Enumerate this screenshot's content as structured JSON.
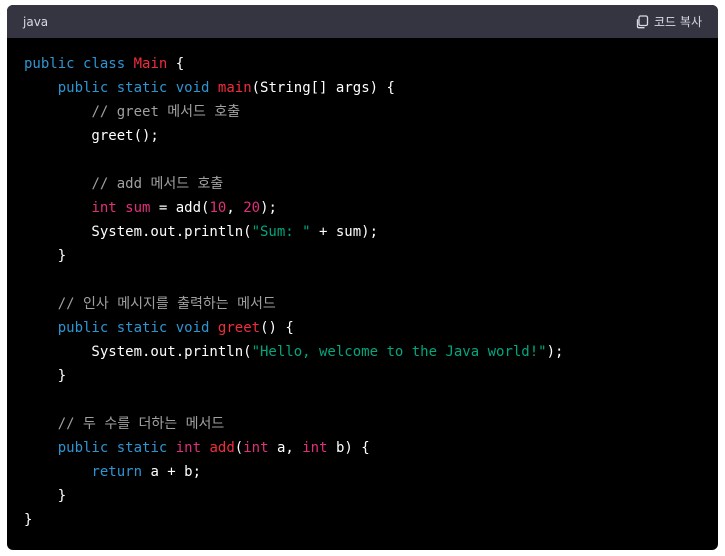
{
  "header": {
    "language": "java",
    "copy_label": "코드 복사",
    "copy_icon": "copy-icon"
  },
  "colors": {
    "keyword": "#2e95d3",
    "class_name": "#f22c3d",
    "function_name": "#f22c3d",
    "type_int": "#df3079",
    "number": "#df3079",
    "string": "#00a67d",
    "comment": "#a0a0a0",
    "plain": "#ffffff",
    "background": "#000000",
    "header_bg": "#343541"
  },
  "code": {
    "lines": [
      [
        {
          "t": "public",
          "c": "kw"
        },
        {
          "t": " ",
          "c": "pl"
        },
        {
          "t": "class",
          "c": "kw"
        },
        {
          "t": " ",
          "c": "pl"
        },
        {
          "t": "Main",
          "c": "cls"
        },
        {
          "t": " {",
          "c": "pl"
        }
      ],
      [
        {
          "t": "    ",
          "c": "pl"
        },
        {
          "t": "public",
          "c": "kw"
        },
        {
          "t": " ",
          "c": "pl"
        },
        {
          "t": "static",
          "c": "kw"
        },
        {
          "t": " ",
          "c": "pl"
        },
        {
          "t": "void",
          "c": "kw"
        },
        {
          "t": " ",
          "c": "pl"
        },
        {
          "t": "main",
          "c": "fn"
        },
        {
          "t": "(String[] args) {",
          "c": "pl"
        }
      ],
      [
        {
          "t": "        ",
          "c": "pl"
        },
        {
          "t": "// greet 메서드 호출",
          "c": "cm"
        }
      ],
      [
        {
          "t": "        greet();",
          "c": "pl"
        }
      ],
      [
        {
          "t": "",
          "c": "pl"
        }
      ],
      [
        {
          "t": "        ",
          "c": "pl"
        },
        {
          "t": "// add 메서드 호출",
          "c": "cm"
        }
      ],
      [
        {
          "t": "        ",
          "c": "pl"
        },
        {
          "t": "int",
          "c": "dt"
        },
        {
          "t": " ",
          "c": "pl"
        },
        {
          "t": "sum",
          "c": "dt"
        },
        {
          "t": " = add(",
          "c": "pl"
        },
        {
          "t": "10",
          "c": "num"
        },
        {
          "t": ", ",
          "c": "pl"
        },
        {
          "t": "20",
          "c": "num"
        },
        {
          "t": ");",
          "c": "pl"
        }
      ],
      [
        {
          "t": "        System.out.println(",
          "c": "pl"
        },
        {
          "t": "\"Sum: \"",
          "c": "str"
        },
        {
          "t": " + sum);",
          "c": "pl"
        }
      ],
      [
        {
          "t": "    }",
          "c": "pl"
        }
      ],
      [
        {
          "t": "",
          "c": "pl"
        }
      ],
      [
        {
          "t": "    ",
          "c": "pl"
        },
        {
          "t": "// 인사 메시지를 출력하는 메서드",
          "c": "cm"
        }
      ],
      [
        {
          "t": "    ",
          "c": "pl"
        },
        {
          "t": "public",
          "c": "kw"
        },
        {
          "t": " ",
          "c": "pl"
        },
        {
          "t": "static",
          "c": "kw"
        },
        {
          "t": " ",
          "c": "pl"
        },
        {
          "t": "void",
          "c": "kw"
        },
        {
          "t": " ",
          "c": "pl"
        },
        {
          "t": "greet",
          "c": "fn"
        },
        {
          "t": "() {",
          "c": "pl"
        }
      ],
      [
        {
          "t": "        System.out.println(",
          "c": "pl"
        },
        {
          "t": "\"Hello, welcome to the Java world!\"",
          "c": "str"
        },
        {
          "t": ");",
          "c": "pl"
        }
      ],
      [
        {
          "t": "    }",
          "c": "pl"
        }
      ],
      [
        {
          "t": "",
          "c": "pl"
        }
      ],
      [
        {
          "t": "    ",
          "c": "pl"
        },
        {
          "t": "// 두 수를 더하는 메서드",
          "c": "cm"
        }
      ],
      [
        {
          "t": "    ",
          "c": "pl"
        },
        {
          "t": "public",
          "c": "kw"
        },
        {
          "t": " ",
          "c": "pl"
        },
        {
          "t": "static",
          "c": "kw"
        },
        {
          "t": " ",
          "c": "pl"
        },
        {
          "t": "int",
          "c": "dt"
        },
        {
          "t": " ",
          "c": "pl"
        },
        {
          "t": "add",
          "c": "fn"
        },
        {
          "t": "(",
          "c": "pl"
        },
        {
          "t": "int",
          "c": "dt"
        },
        {
          "t": " a, ",
          "c": "pl"
        },
        {
          "t": "int",
          "c": "dt"
        },
        {
          "t": " b) {",
          "c": "pl"
        }
      ],
      [
        {
          "t": "        ",
          "c": "pl"
        },
        {
          "t": "return",
          "c": "kw"
        },
        {
          "t": " a + b;",
          "c": "pl"
        }
      ],
      [
        {
          "t": "    }",
          "c": "pl"
        }
      ],
      [
        {
          "t": "}",
          "c": "pl"
        }
      ]
    ]
  }
}
